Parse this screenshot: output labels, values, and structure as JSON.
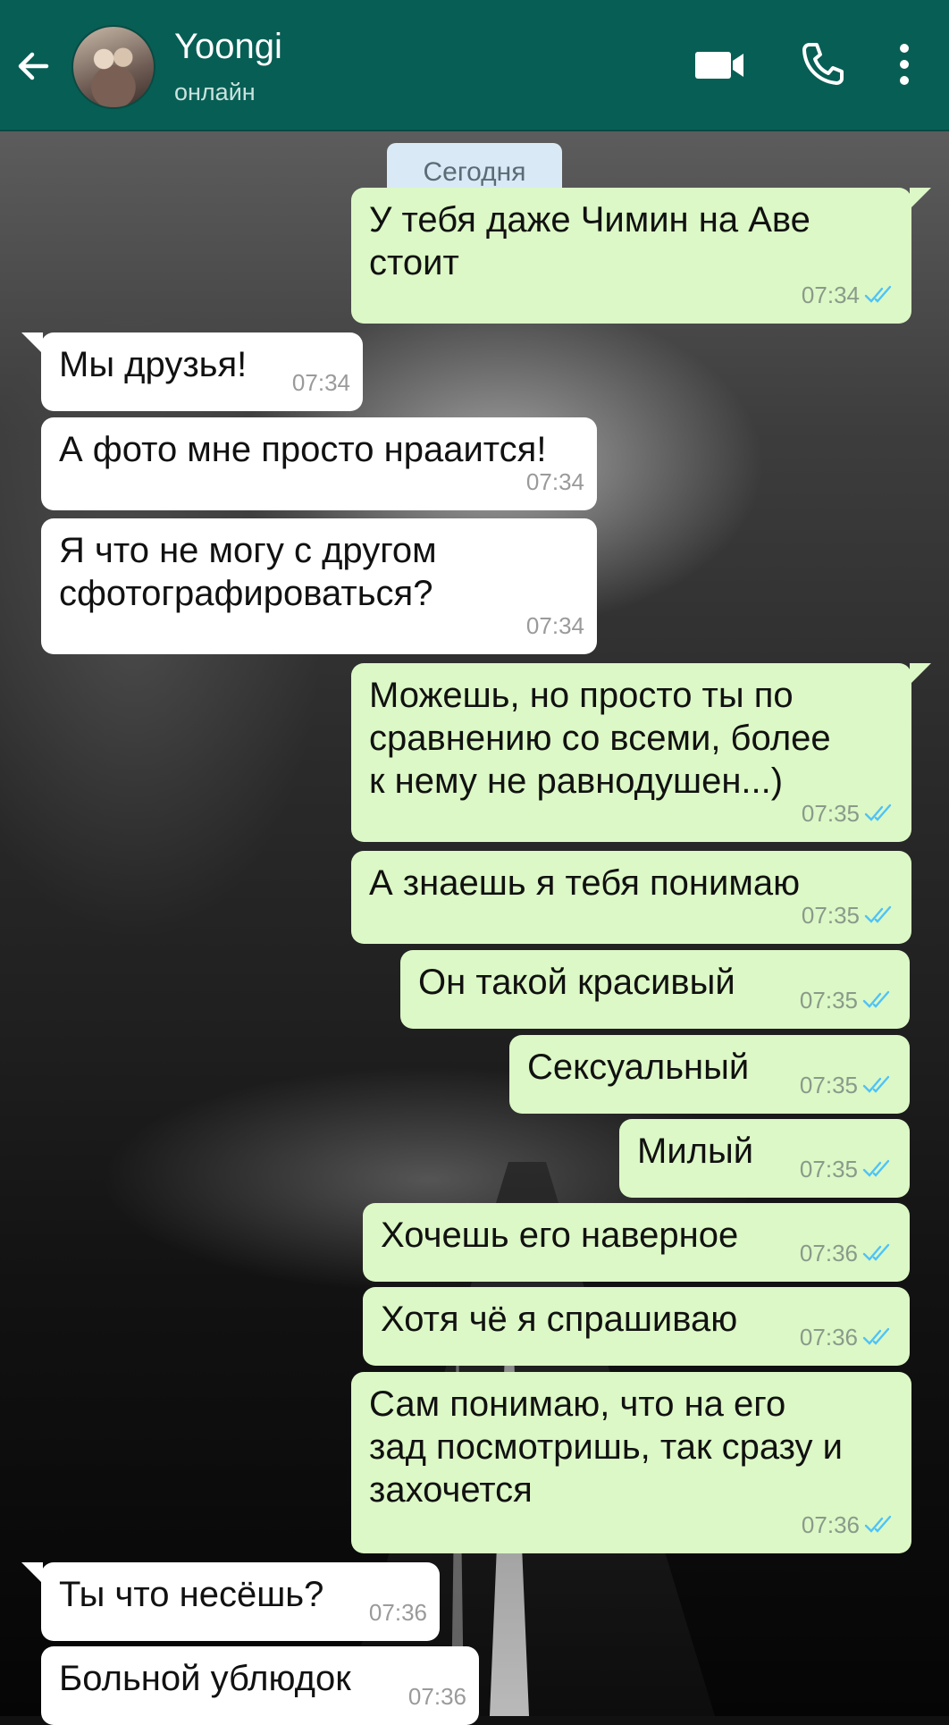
{
  "header": {
    "contact_name": "Yoongi",
    "status": "онлайн",
    "icons": [
      "back-arrow-icon",
      "avatar",
      "video-call-icon",
      "phone-icon",
      "more-menu-icon"
    ]
  },
  "date_chip": "Сегодня",
  "colors": {
    "header": "#075e54",
    "outgoing": "#dcf8c6",
    "incoming": "#ffffff",
    "read_ticks": "#4fc3f7"
  },
  "messages": [
    {
      "dir": "out",
      "text": "У тебя даже Чимин на Аве\nстоит",
      "time": "07:34",
      "read": true
    },
    {
      "dir": "in",
      "text": "Мы друзья!",
      "time": "07:34"
    },
    {
      "dir": "in",
      "text": "А фото мне просто нрааится!",
      "time": "07:34"
    },
    {
      "dir": "in",
      "text": "Я что не могу с другом\nсфотографироваться?",
      "time": "07:34"
    },
    {
      "dir": "out",
      "text": "Можешь, но просто ты по\nсравнению со всеми, более\nк нему не равнодушен...)",
      "time": "07:35",
      "read": true
    },
    {
      "dir": "out",
      "text": "А знаешь я тебя понимаю",
      "time": "07:35",
      "read": true
    },
    {
      "dir": "out",
      "text": "Он такой красивый",
      "time": "07:35",
      "read": true
    },
    {
      "dir": "out",
      "text": "Сексуальный",
      "time": "07:35",
      "read": true
    },
    {
      "dir": "out",
      "text": "Милый",
      "time": "07:35",
      "read": true
    },
    {
      "dir": "out",
      "text": "Хочешь его наверное",
      "time": "07:36",
      "read": true
    },
    {
      "dir": "out",
      "text": "Хотя чё я спрашиваю",
      "time": "07:36",
      "read": true
    },
    {
      "dir": "out",
      "text": "Сам понимаю, что на его\nзад посмотришь, так сразу и\nзахочется",
      "time": "07:36",
      "read": true
    },
    {
      "dir": "in",
      "text": "Ты что несёшь?",
      "time": "07:36"
    },
    {
      "dir": "in",
      "text": "Больной ублюдок",
      "time": "07:36"
    }
  ]
}
